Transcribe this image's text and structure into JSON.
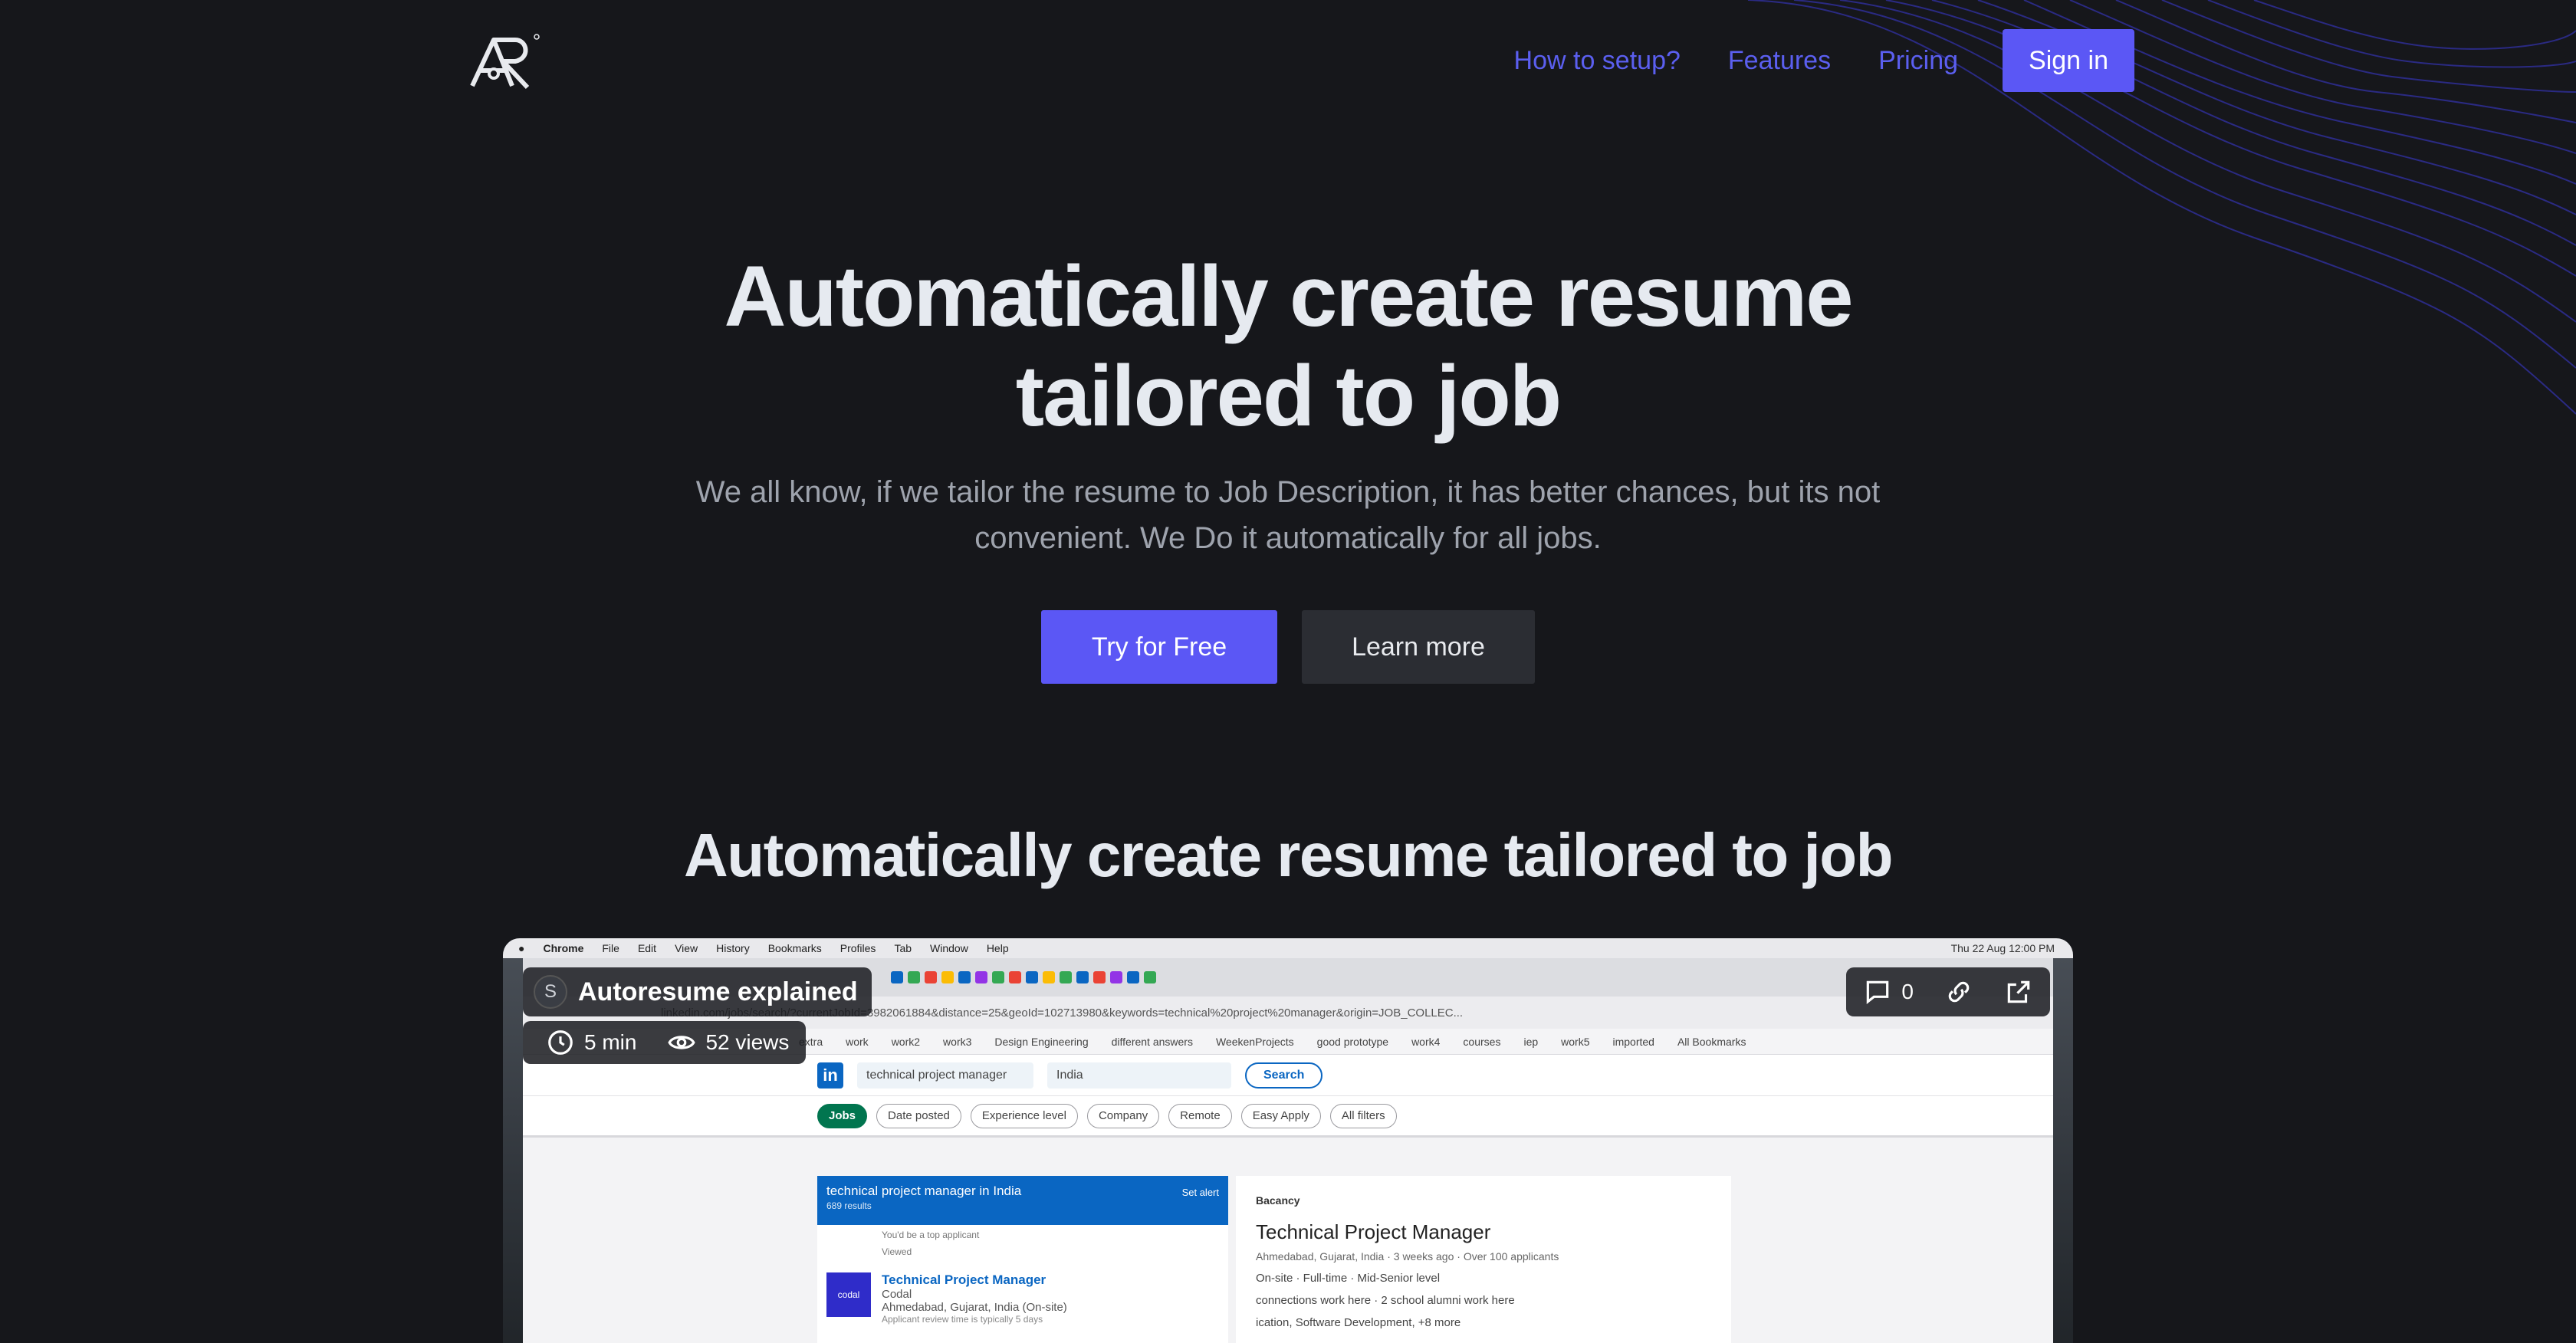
{
  "nav": {
    "logo_text": "AR",
    "links": [
      "How to setup?",
      "Features",
      "Pricing"
    ],
    "signin_label": "Sign in"
  },
  "hero": {
    "title_line1": "Automatically create resume",
    "title_line2": "tailored to job",
    "subtitle": "We all know, if we tailor the resume to Job Description, it has better chances, but its not convenient. We Do it automatically for all jobs.",
    "primary_cta": "Try for Free",
    "secondary_cta": "Learn more"
  },
  "section": {
    "title": "Automatically create resume tailored to job"
  },
  "video": {
    "title": "Autoresume explained",
    "author_initial": "S",
    "duration": "5 min",
    "views": "52 views",
    "comments": "0",
    "mac_menu": [
      "Chrome",
      "File",
      "Edit",
      "View",
      "History",
      "Bookmarks",
      "Profiles",
      "Tab",
      "Window",
      "Help"
    ],
    "mac_clock": "Thu 22 Aug 12:00 PM",
    "url": "linkedin.com/jobs/search/?currentJobId=3982061884&distance=25&geoId=102713980&keywords=technical%20project%20manager&origin=JOB_COLLEC...",
    "bookmarks": [
      "extra",
      "work",
      "work2",
      "work3",
      "Design Engineering",
      "different answers",
      "WeekenProjects",
      "good prototype",
      "work4",
      "courses",
      "iep",
      "work5",
      "imported",
      "All Bookmarks"
    ],
    "search_query": "technical project manager",
    "search_location": "India",
    "search_button": "Search",
    "filters": [
      "Jobs",
      "Date posted",
      "Experience level",
      "Company",
      "Remote",
      "Easy Apply",
      "All filters"
    ],
    "results_title": "technical project manager in India",
    "results_count": "689 results",
    "set_alert": "Set alert",
    "top_applicant": "You'd be a top applicant",
    "viewed": "Viewed",
    "job_title": "Technical Project Manager",
    "job_company": "Codal",
    "job_logo_text": "codal",
    "job_location": "Ahmedabad, Gujarat, India (On-site)",
    "job_review": "Applicant review time is typically 5 days",
    "detail_company": "Bacancy",
    "detail_title": "Technical Project Manager",
    "detail_meta": "Ahmedabad, Gujarat, India · 3 weeks ago · Over 100 applicants",
    "detail_tags": "On-site · Full-time · Mid-Senior level",
    "detail_connections": "connections work here · 2 school alumni work here",
    "detail_skills": "ication, Software Development, +8 more"
  }
}
